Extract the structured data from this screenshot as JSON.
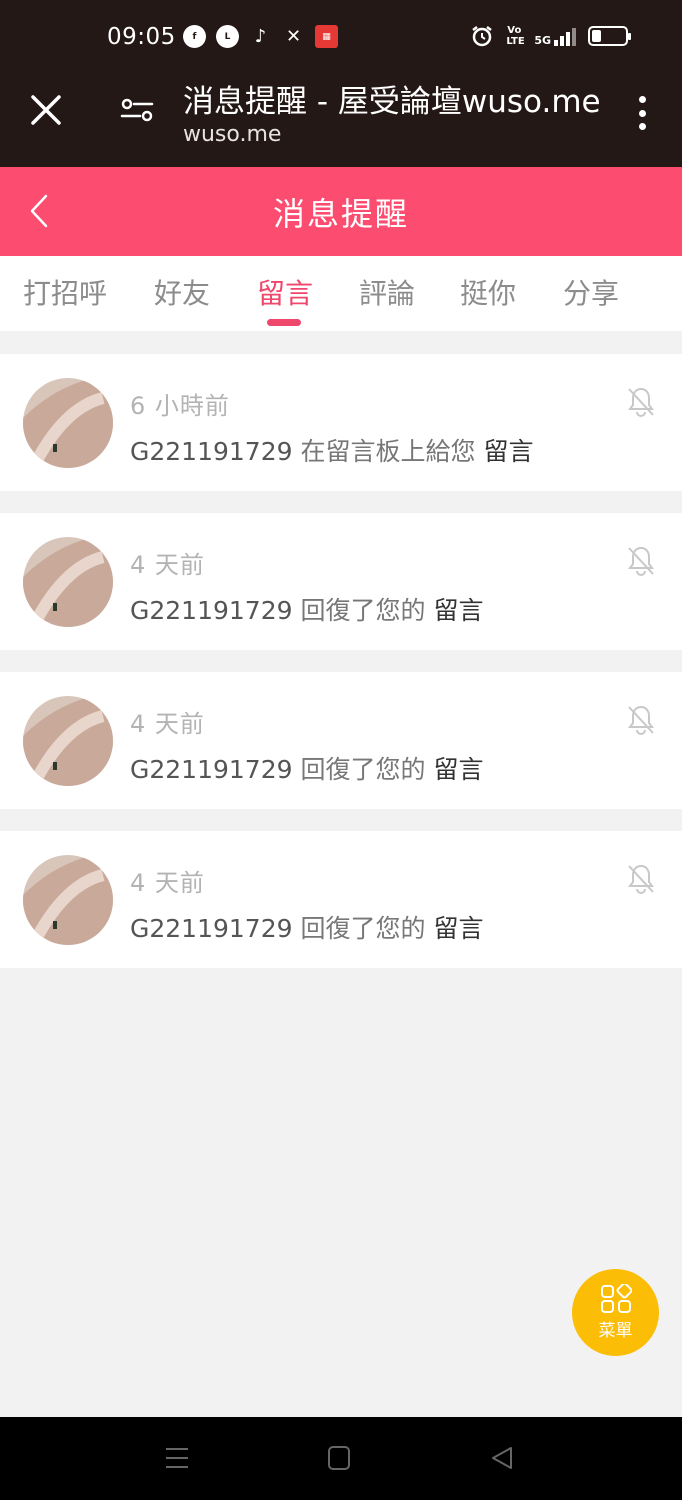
{
  "status": {
    "time": "09:05",
    "volte": "Vo LTE",
    "network": "5G"
  },
  "browser": {
    "title": "消息提醒 - 屋受論壇wuso.me",
    "url": "wuso.me"
  },
  "header": {
    "title": "消息提醒"
  },
  "tabs": [
    {
      "label": "打招呼"
    },
    {
      "label": "好友"
    },
    {
      "label": "留言"
    },
    {
      "label": "評論"
    },
    {
      "label": "挺你"
    },
    {
      "label": "分享"
    }
  ],
  "active_tab": "留言",
  "notifications": [
    {
      "time": "6 小時前",
      "user": "G221191729",
      "text": " 在留言板上給您 ",
      "action": "留言"
    },
    {
      "time": "4 天前",
      "user": "G221191729",
      "text": " 回復了您的 ",
      "action": "留言"
    },
    {
      "time": "4 天前",
      "user": "G221191729",
      "text": " 回復了您的 ",
      "action": "留言"
    },
    {
      "time": "4 天前",
      "user": "G221191729",
      "text": " 回復了您的 ",
      "action": "留言"
    }
  ],
  "fab": {
    "label": "菜單"
  },
  "colors": {
    "header": "#fc4c6f",
    "accent": "#f0476c",
    "status_bar": "#231815",
    "fab": "#fbbd05"
  }
}
